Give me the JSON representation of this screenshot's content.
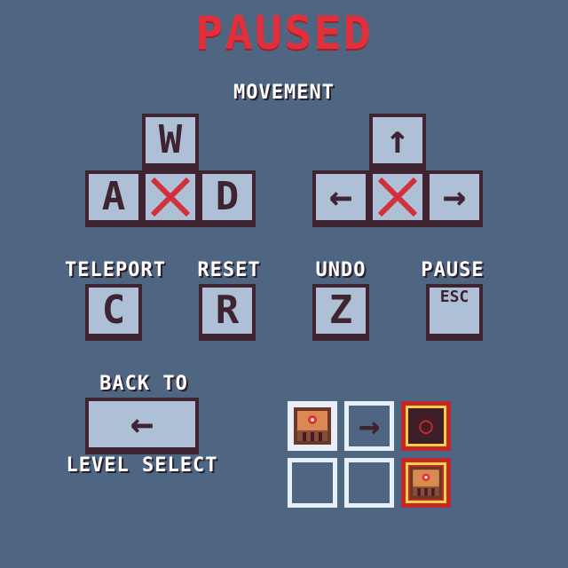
{
  "title": "PAUSED",
  "sections": {
    "movement_label": "MOVEMENT",
    "wasd_keys": [
      "W",
      "A",
      "D"
    ],
    "arrow_keys": [
      "↑",
      "←",
      "→"
    ]
  },
  "actions": [
    {
      "label": "TELEPORT",
      "key": "C"
    },
    {
      "label": "RESET",
      "key": "R"
    },
    {
      "label": "UNDO",
      "key": "Z"
    },
    {
      "label": "PAUSE",
      "key": "ESC"
    }
  ],
  "back": {
    "top_label": "BACK TO",
    "bottom_label": "LEVEL SELECT",
    "key_glyph": "←"
  },
  "hint": {
    "arrow_glyph": "→",
    "goal_glyph": "○"
  },
  "colors": {
    "background": "#4f6682",
    "title": "#e0303c",
    "key_face": "#aec0d6",
    "key_border": "#3d2430",
    "disabled_cross": "#d03038",
    "goal_border": "#c02830",
    "goal_highlight": "#f5d040"
  }
}
